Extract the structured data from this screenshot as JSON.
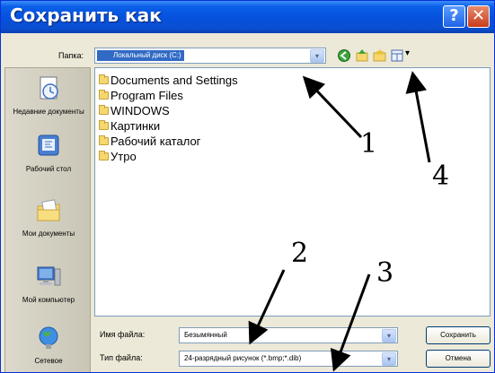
{
  "window": {
    "title": "Сохранить как",
    "help_glyph": "?",
    "close_glyph": "✕"
  },
  "toolbar": {
    "folder_label": "Папка:",
    "folder_value": "Локальный диск (C:)",
    "back_icon": "back-arrow-icon",
    "up_icon": "up-folder-icon",
    "new_folder_icon": "new-folder-icon",
    "view_icon": "views-menu-icon",
    "dropdown_glyph": "▾",
    "views_glyph": "▾"
  },
  "places": [
    {
      "label": "Недавние документы",
      "icon": "recent-documents-icon"
    },
    {
      "label": "Рабочий стол",
      "icon": "desktop-icon"
    },
    {
      "label": "Мои документы",
      "icon": "my-documents-icon"
    },
    {
      "label": "Мой компьютер",
      "icon": "my-computer-icon"
    },
    {
      "label": "Сетевое",
      "icon": "network-icon"
    }
  ],
  "files": [
    "Documents and Settings",
    "Program Files",
    "WINDOWS",
    "Картинки",
    "Рабочий каталог",
    "Утро"
  ],
  "form": {
    "filename_label": "Имя файла:",
    "filename_value": "Безымянный",
    "filetype_label": "Тип файла:",
    "filetype_value": "24-разрядный рисунок (*.bmp;*.dib)"
  },
  "buttons": {
    "save": "Сохранить",
    "cancel": "Отмена"
  },
  "annotations": [
    "1",
    "2",
    "3",
    "4"
  ],
  "colors": {
    "title_bar": "#0550dc",
    "selection": "#316ac5",
    "window_bg": "#ece9d8"
  }
}
